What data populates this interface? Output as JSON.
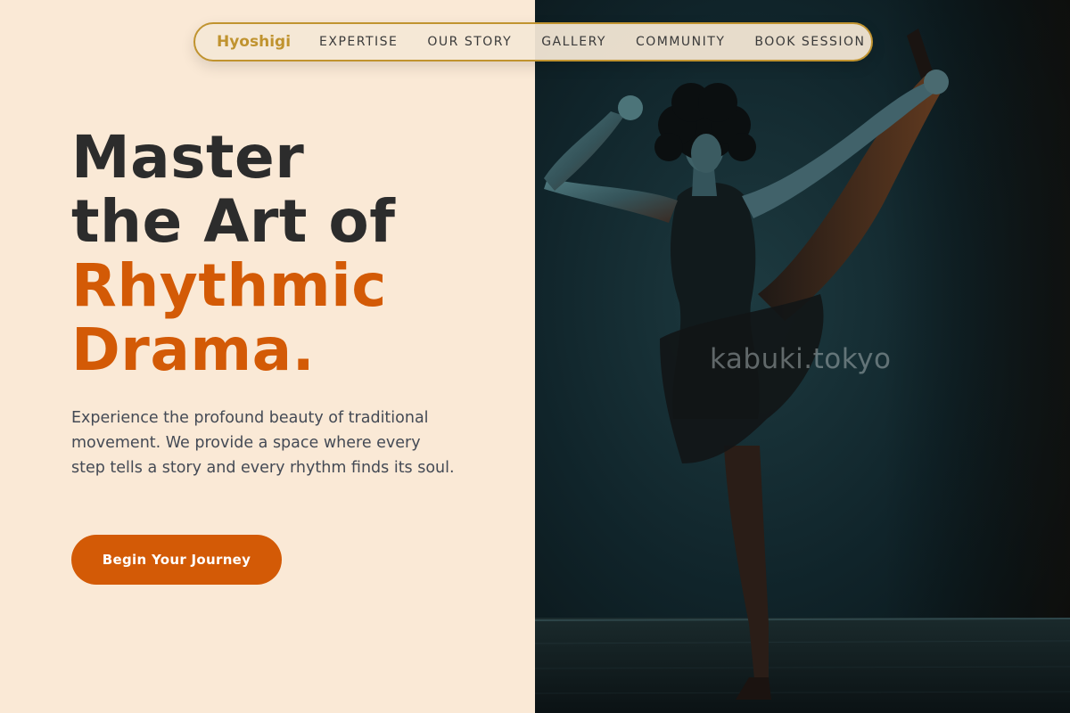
{
  "nav": {
    "brand": "Hyoshigi",
    "links": [
      "EXPERTISE",
      "OUR STORY",
      "GALLERY",
      "COMMUNITY",
      "BOOK SESSION"
    ]
  },
  "hero": {
    "title_lines": [
      "Master",
      "the Art of",
      "Rhythmic",
      "Drama."
    ],
    "description": "Experience the profound beauty of traditional movement. We provide a space where every step tells a story and every rhythm finds its soul.",
    "cta_label": "Begin Your Journey"
  },
  "image": {
    "watermark": "kabuki.tokyo"
  },
  "colors": {
    "background": "#fae9d6",
    "accent": "#d35a06",
    "brand": "#c0932f",
    "heading": "#2c2c2c",
    "body_text": "#444a55"
  }
}
